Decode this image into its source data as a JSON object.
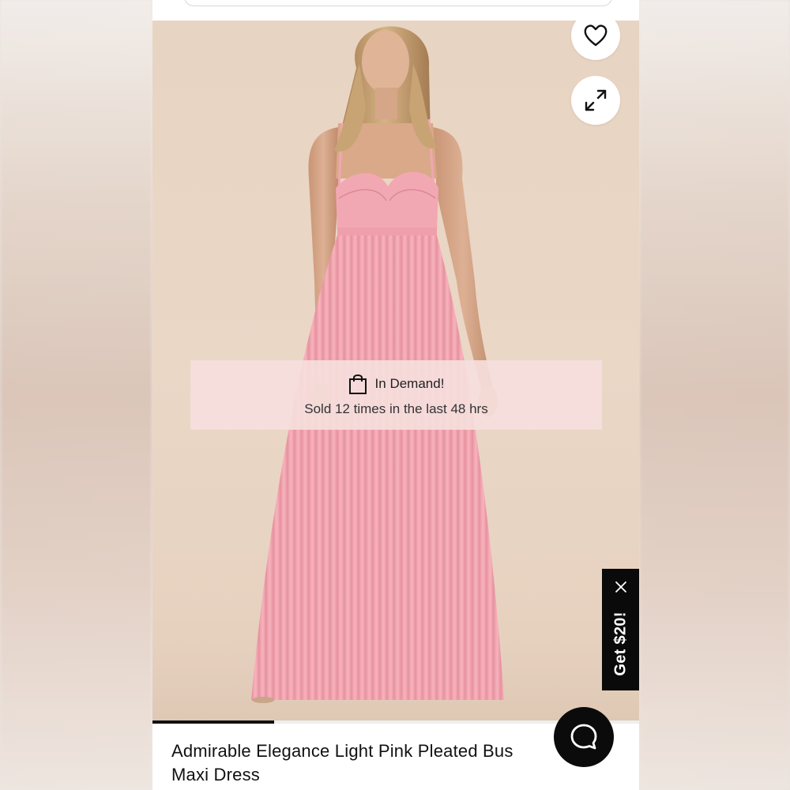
{
  "product": {
    "title": "Admirable Elegance Light Pink Pleated Bus",
    "title_line2": "Maxi Dress"
  },
  "badge": {
    "title": "In Demand!",
    "subtitle": "Sold 12 times in the last 48 hrs"
  },
  "promo": {
    "label": "Get $20!"
  },
  "gallery": {
    "progress_fraction": 0.25
  },
  "icons": {
    "favorite": "heart-icon",
    "expand": "expand-arrows-icon",
    "badge": "shopping-bag-icon",
    "close": "close-icon",
    "chat": "chat-bubble-icon"
  },
  "colors": {
    "dress": "#f3a8b2",
    "background": "#e8d4c2",
    "promo_bg": "#0a0a0a",
    "badge_bg": "#f5dedc"
  }
}
